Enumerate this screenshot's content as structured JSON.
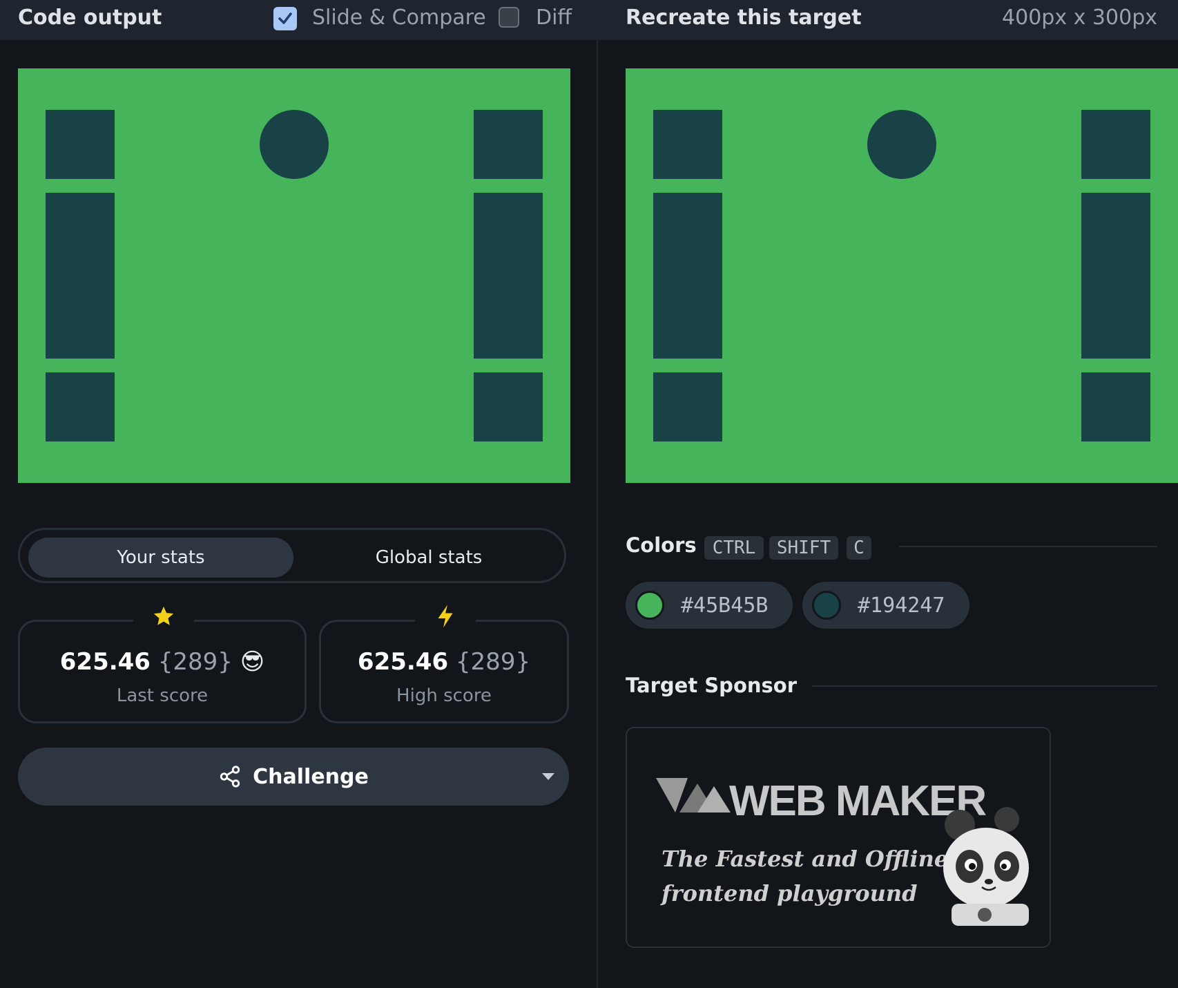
{
  "header": {
    "left_title": "Code output",
    "slide_compare_label": "Slide & Compare",
    "slide_compare_checked": true,
    "diff_label": "Diff",
    "diff_checked": false,
    "right_title": "Recreate this target",
    "size_label": "400px x 300px"
  },
  "stats": {
    "tabs": [
      "Your stats",
      "Global stats"
    ],
    "active_tab": "Your stats",
    "last": {
      "value": "625.46",
      "paren": "{289}",
      "emoji": "😎",
      "label": "Last score",
      "icon": "star-icon"
    },
    "high": {
      "value": "625.46",
      "paren": "{289}",
      "label": "High score",
      "icon": "lightning-icon"
    }
  },
  "challenge": {
    "label": "Challenge",
    "icon": "share-icon"
  },
  "colors": {
    "title": "Colors",
    "shortcut": [
      "CTRL",
      "SHIFT",
      "C"
    ],
    "swatches": [
      {
        "hex": "#45B45B",
        "color": "#45b45b"
      },
      {
        "hex": "#194247",
        "color": "#194247"
      }
    ]
  },
  "sponsor": {
    "title": "Target Sponsor",
    "logo_text": "WEB MAKER",
    "tagline_1": "The Fastest and Offline",
    "tagline_2": "frontend playground"
  }
}
